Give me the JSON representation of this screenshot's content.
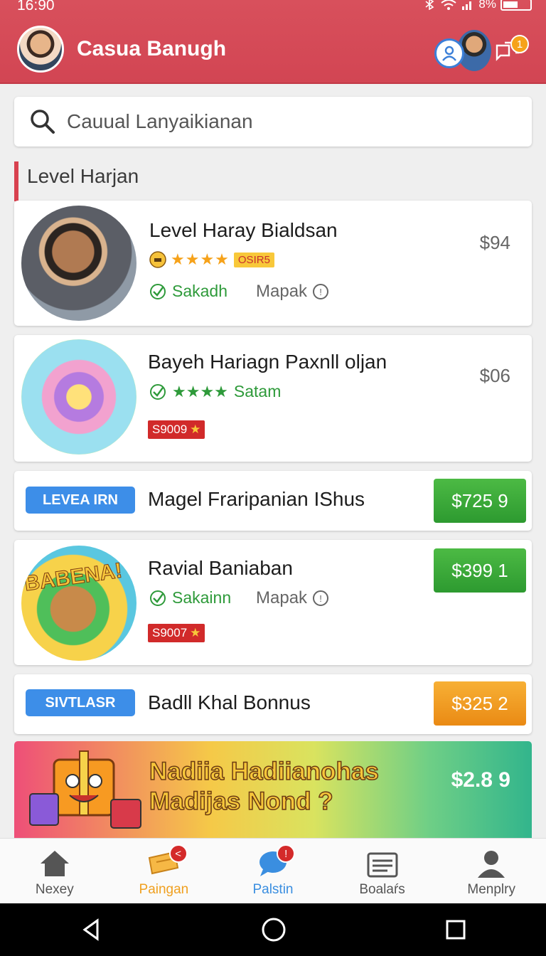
{
  "status_bar": {
    "time": "16:90",
    "battery": "8%"
  },
  "header": {
    "title": "Casua Banugh",
    "notification_count": "1"
  },
  "search": {
    "placeholder": "Cauual Lanyaikianan"
  },
  "section": {
    "title": "Level Harjan"
  },
  "cards": [
    {
      "title": "Level Haray Bialdsan",
      "price": "$94",
      "rating": "★★★★",
      "tag": "OSIR5",
      "status": "Sakadh",
      "secondary": "Mapak"
    },
    {
      "title": "Bayeh Hariagn Paxnll oljan",
      "price": "$06",
      "rating": "★★★★",
      "status": "Satam",
      "code": "S9009"
    },
    {
      "pill": "LEVEA IRN",
      "title": "Magel Fraripanian IShus",
      "price": "$725 9"
    },
    {
      "title": "Ravial Baniaban",
      "price": "$399 1",
      "status": "Sakainn",
      "secondary": "Mapak",
      "code": "S9007",
      "art_text": "BABENA!"
    },
    {
      "pill": "SIVTLASR",
      "title": "Badll Khal Bonnus",
      "price": "$325 2"
    }
  ],
  "banner": {
    "line1": "Nadiia Hadiianohas",
    "line2": "Madijas Nond ?",
    "price": "$2.8 9"
  },
  "bottom_nav": [
    {
      "label": "Nexey",
      "icon": "home-icon"
    },
    {
      "label": "Paingan",
      "icon": "ticket-icon",
      "badge": "<"
    },
    {
      "label": "Palstin",
      "icon": "chat-bubble-icon",
      "badge": "!"
    },
    {
      "label": "Boalaŕs",
      "icon": "board-icon"
    },
    {
      "label": "Menplry",
      "icon": "person-icon"
    }
  ],
  "colors": {
    "header": "#d24553",
    "accent_green": "#2e9a3a",
    "accent_orange": "#ea8a14",
    "accent_blue": "#3d8ee8"
  }
}
